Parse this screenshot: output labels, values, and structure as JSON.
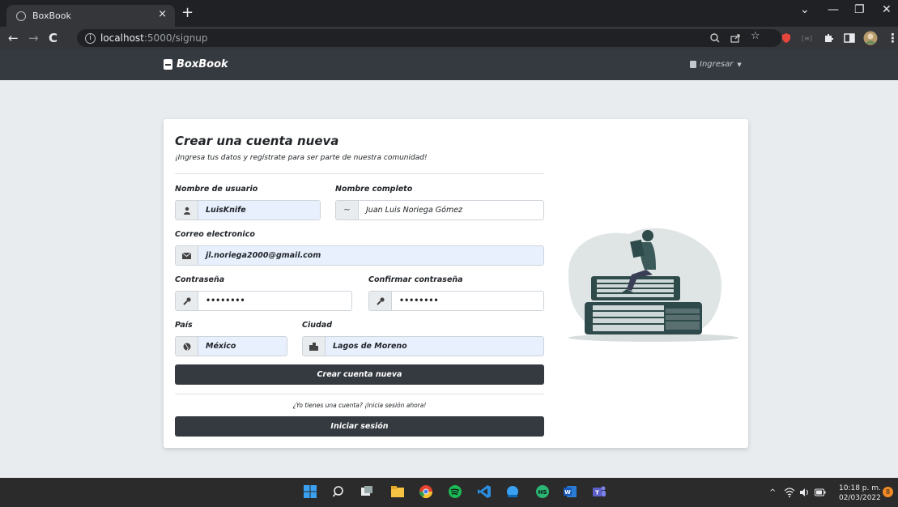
{
  "browser": {
    "tab_title": "BoxBook",
    "tab_close": "×",
    "new_tab": "+",
    "url_host": "localhost",
    "url_path": ":5000/signup",
    "info_icon": "i",
    "win_min": "—",
    "win_restore": "❐",
    "win_close": "✕",
    "win_dropdown": "⌄"
  },
  "navbar": {
    "brand": "BoxBook",
    "login": "Ingresar"
  },
  "form": {
    "title": "Crear una cuenta nueva",
    "subtitle": "¡Ingresa tus datos y regístrate para ser parte de nuestra comunidad!",
    "username_label": "Nombre de usuario",
    "username_value": "LuisKnife",
    "fullname_label": "Nombre completo",
    "fullname_value": "Juan Luis Noriega Gómez",
    "email_label": "Correo electronico",
    "email_value": "jl.noriega2000@gmail.com",
    "password_label": "Contraseña",
    "password_value": "••••••••",
    "confirm_label": "Confirmar contraseña",
    "confirm_value": "••••••••",
    "country_label": "País",
    "country_value": "México",
    "city_label": "Ciudad",
    "city_value": "Lagos de Moreno",
    "submit": "Crear cuenta nueva",
    "have_account": "¿Yo tienes una cuenta? ¡Inicia sesión ahora!",
    "login_button": "Iniciar sesión"
  },
  "icons": {
    "user": "user-icon",
    "signature": "signature-icon",
    "email": "envelope-icon",
    "key": "key-icon",
    "globe": "globe-icon",
    "city": "city-icon"
  },
  "taskbar": {
    "time": "10:18 p. m.",
    "date": "02/03/2022",
    "notifications": "8"
  },
  "colors": {
    "navbar": "#343a40",
    "button": "#343a40",
    "autofill": "#e8f0fe",
    "illustration": "#2f4a4a"
  }
}
